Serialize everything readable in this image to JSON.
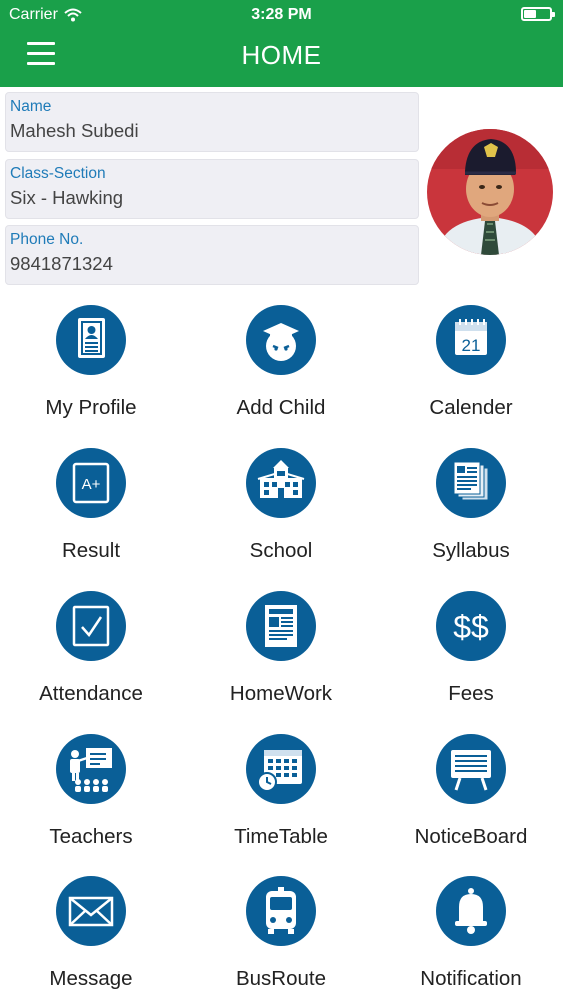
{
  "status_bar": {
    "carrier": "Carrier",
    "time": "3:28 PM"
  },
  "header": {
    "title": "HOME"
  },
  "profile": {
    "fields": [
      {
        "label": "Name",
        "value": "Mahesh Subedi"
      },
      {
        "label": "Class-Section",
        "value": "Six - Hawking"
      },
      {
        "label": "Phone No.",
        "value": "9841871324"
      }
    ]
  },
  "menu": {
    "items": [
      {
        "label": "My Profile",
        "icon": "profile-card-icon"
      },
      {
        "label": "Add Child",
        "icon": "graduate-icon"
      },
      {
        "label": "Calender",
        "icon": "calendar-icon",
        "icon_text": "21"
      },
      {
        "label": "Result",
        "icon": "result-icon",
        "icon_text": "A+"
      },
      {
        "label": "School",
        "icon": "school-building-icon"
      },
      {
        "label": "Syllabus",
        "icon": "syllabus-icon"
      },
      {
        "label": "Attendance",
        "icon": "attendance-check-icon"
      },
      {
        "label": "HomeWork",
        "icon": "homework-icon"
      },
      {
        "label": "Fees",
        "icon": "fees-icon",
        "icon_text": "$$"
      },
      {
        "label": "Teachers",
        "icon": "teacher-icon"
      },
      {
        "label": "TimeTable",
        "icon": "timetable-icon"
      },
      {
        "label": "NoticeBoard",
        "icon": "noticeboard-icon"
      },
      {
        "label": "Message",
        "icon": "envelope-icon"
      },
      {
        "label": "BusRoute",
        "icon": "bus-icon"
      },
      {
        "label": "Notification",
        "icon": "bell-icon"
      }
    ]
  },
  "colors": {
    "header": "#1aa04a",
    "icon_circle": "#0a5f97",
    "field_label": "#1f7bb8"
  }
}
